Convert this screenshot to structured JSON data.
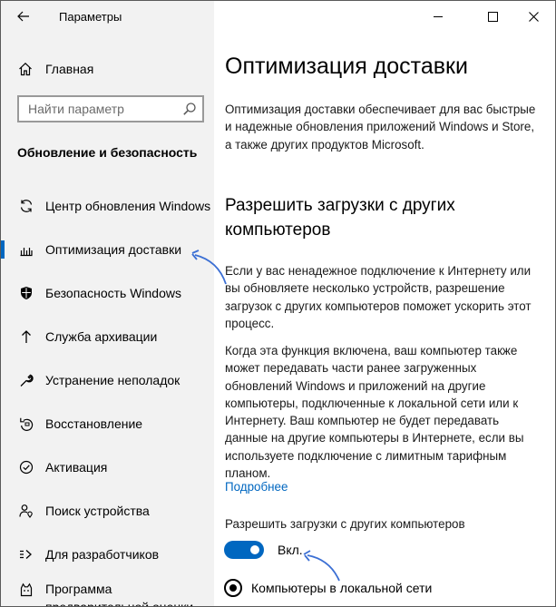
{
  "titlebar": {
    "app_title": "Параметры",
    "back_icon": "back-arrow-icon",
    "window_controls": [
      "minimize-icon",
      "maximize-icon",
      "close-icon"
    ]
  },
  "sidebar": {
    "home_label": "Главная",
    "search": {
      "placeholder": "Найти параметр"
    },
    "section_title": "Обновление и безопасность",
    "items": [
      {
        "label": "Центр обновления Windows",
        "icon": "refresh-icon",
        "selected": false
      },
      {
        "label": "Оптимизация доставки",
        "icon": "delivery-optimization-icon",
        "selected": true
      },
      {
        "label": "Безопасность Windows",
        "icon": "shield-icon",
        "selected": false
      },
      {
        "label": "Служба архивации",
        "icon": "backup-arrow-icon",
        "selected": false
      },
      {
        "label": "Устранение неполадок",
        "icon": "wrench-icon",
        "selected": false
      },
      {
        "label": "Восстановление",
        "icon": "recovery-icon",
        "selected": false
      },
      {
        "label": "Активация",
        "icon": "activation-check-icon",
        "selected": false
      },
      {
        "label": "Поиск устройства",
        "icon": "person-location-icon",
        "selected": false
      },
      {
        "label": "Для разработчиков",
        "icon": "developer-tools-icon",
        "selected": false
      },
      {
        "label": "Программа предварительной оценки Windows",
        "icon": "insider-cat-icon",
        "selected": false
      }
    ],
    "accent_color": "#0067c0"
  },
  "main": {
    "title": "Оптимизация доставки",
    "intro_lines": [
      "Оптимизация доставки обеспечивает для вас быстрые",
      "и надежные обновления приложений Windows и Store,",
      "а также других продуктов Microsoft."
    ],
    "subtitle_lines": [
      "Разрешить загрузки с других",
      "компьютеров"
    ],
    "para1_lines": [
      "Если у вас ненадежное подключение к Интернету или",
      "вы обновляете несколько устройств, разрешение",
      "загрузок с других компьютеров поможет ускорить этот",
      "процесс."
    ],
    "para2_lines": [
      "Когда эта функция включена, ваш компьютер также",
      "может передавать части ранее загруженных",
      "обновлений Windows и приложений на другие",
      "компьютеры, подключенные к локальной сети или к",
      "Интернету. Ваш компьютер не будет передавать",
      "данные на другие компьютеры в Интернете, если вы",
      "используете подключение с лимитным тарифным",
      "планом."
    ],
    "learn_more": "Подробнее",
    "toggle": {
      "label": "Разрешить загрузки с других компьютеров",
      "state_text": "Вкл.",
      "on": true
    },
    "radio": {
      "label": "Компьютеры в локальной сети",
      "selected": true
    }
  },
  "annotation_arrow_color": "#3b6fd4"
}
